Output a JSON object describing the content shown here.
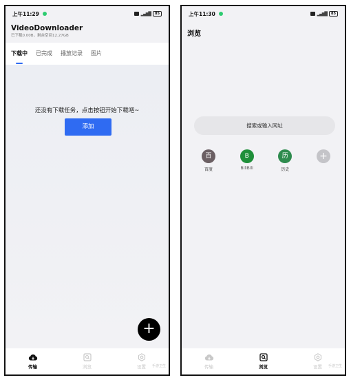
{
  "left_screen": {
    "status_bar": {
      "time": "上午11:29",
      "battery": "85"
    },
    "app_title": "VideoDownloader",
    "storage_info": "已下载0.00B，剩余空间12.27GB",
    "tabs": [
      {
        "label": "下载中",
        "active": true
      },
      {
        "label": "已完成",
        "active": false
      },
      {
        "label": "播放记录",
        "active": false
      },
      {
        "label": "图片",
        "active": false
      }
    ],
    "empty_message": "还没有下载任务，点击按钮开始下载吧~",
    "add_button_label": "添加",
    "fab_symbol": "+"
  },
  "right_screen": {
    "status_bar": {
      "time": "上午11:30",
      "battery": "85"
    },
    "page_title": "浏览",
    "search_placeholder": "搜索或输入网址",
    "shortcuts": [
      {
        "label": "百度",
        "glyph": "百",
        "color": "#6b5f63"
      },
      {
        "label": "BiliBili",
        "glyph": "B",
        "color": "#1f8f3a"
      },
      {
        "label": "历史",
        "glyph": "历",
        "color": "#2e8b4e"
      },
      {
        "label": "",
        "glyph": "+",
        "color": "#c4c4c8"
      }
    ]
  },
  "bottom_nav": {
    "items": [
      {
        "label": "传输",
        "icon": "cloud-download-icon"
      },
      {
        "label": "浏览",
        "icon": "browse-icon"
      },
      {
        "label": "设置",
        "icon": "gear-icon"
      }
    ],
    "watermark": "手游卫生"
  },
  "colors": {
    "accent": "#2f6bf2",
    "status_dot": "#2ecc71",
    "fab": "#000000",
    "inactive_nav": "#c8c8c8"
  }
}
